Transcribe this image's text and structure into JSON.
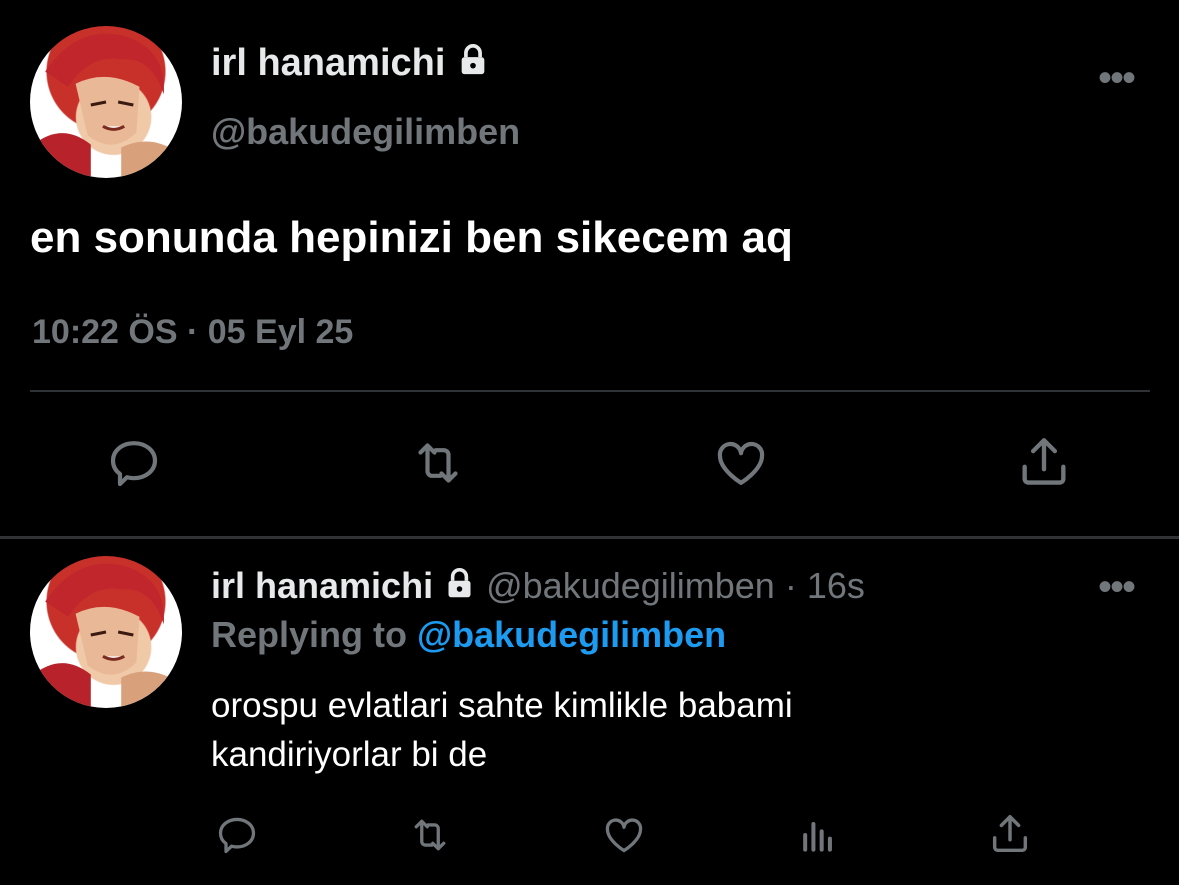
{
  "colors": {
    "background": "#000000",
    "text": "#e7e9ea",
    "muted": "#71767b",
    "link": "#1d9bf0",
    "divider": "#2f3336"
  },
  "main_tweet": {
    "display_name": "irl hanamichi",
    "handle": "@bakudegilimben",
    "text": "en sonunda hepinizi ben sikecem aq",
    "time": "10:22 ÖS",
    "separator": "·",
    "date": "05 Eyl 25",
    "icons": [
      "reply-icon",
      "retweet-icon",
      "like-icon",
      "share-icon"
    ]
  },
  "reply_tweet": {
    "display_name": "irl hanamichi",
    "handle": "@bakudegilimben",
    "separator": "·",
    "age": "16s",
    "replying_prefix": "Replying to",
    "replying_handle": "@bakudegilimben",
    "text_line1": "orospu evlatlari sahte kimlikle babami",
    "text_line2": "kandiriyorlar bi de",
    "icons": [
      "reply-icon",
      "retweet-icon",
      "like-icon",
      "analytics-icon",
      "share-icon"
    ]
  }
}
